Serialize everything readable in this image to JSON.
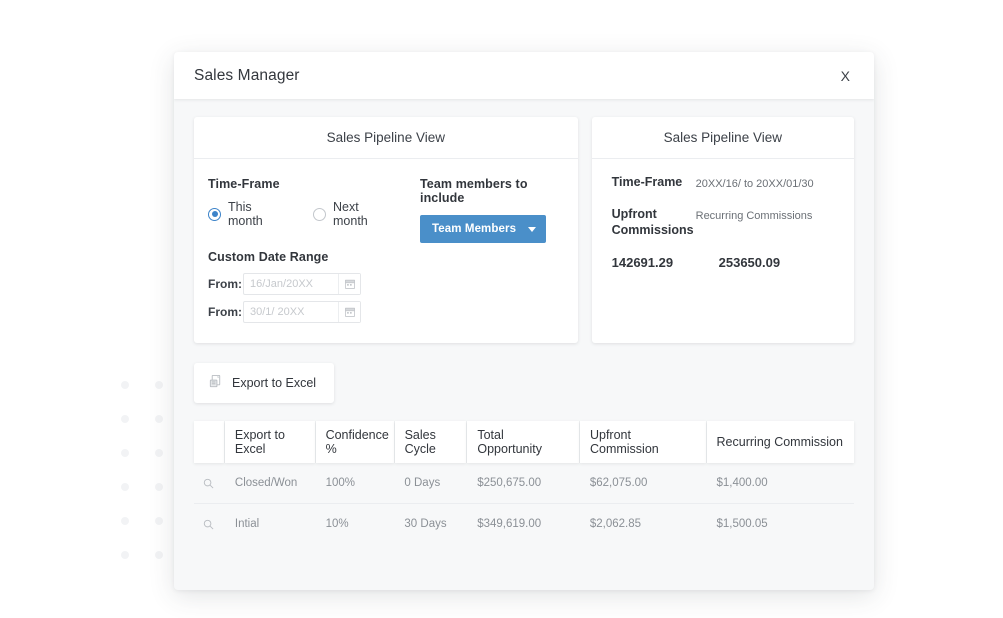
{
  "modal": {
    "title": "Sales Manager",
    "close_label": "X"
  },
  "left_panel": {
    "header": "Sales Pipeline View",
    "time_frame_label": "Time-Frame",
    "radios": [
      {
        "label": "This month",
        "selected": true
      },
      {
        "label": "Next month",
        "selected": false
      }
    ],
    "custom_date_range_label": "Custom Date Range",
    "date_rows": [
      {
        "prefix": "From:",
        "placeholder": "16/Jan/20XX",
        "value": ""
      },
      {
        "prefix": "From:",
        "placeholder": "30/1/ 20XX",
        "value": ""
      }
    ],
    "team_members_label": "Team members to include",
    "team_members_button": "Team Members"
  },
  "right_panel": {
    "header": "Sales Pipeline View",
    "time_frame_key": "Time-Frame",
    "time_frame_value": "20XX/16/ to 20XX/01/30",
    "upfront_key": "Upfront Commissions",
    "recurring_key": "Recurring Commissions",
    "upfront_amount": "142691.29",
    "recurring_amount": "253650.09"
  },
  "export": {
    "label": "Export to Excel"
  },
  "table": {
    "columns": [
      "",
      "Export to Excel",
      "Confidence %",
      "Sales Cycle",
      "Total Opportunity",
      "Upfront Commission",
      "Recurring Commission"
    ],
    "rows": [
      {
        "stage": "Closed/Won",
        "confidence": "100%",
        "sales_cycle": "0 Days",
        "total_opportunity": "$250,675.00",
        "upfront_commission": "$62,075.00",
        "recurring_commission": "$1,400.00"
      },
      {
        "stage": "Intial",
        "confidence": "10%",
        "sales_cycle": "30 Days",
        "total_opportunity": "$349,619.00",
        "upfront_commission": "$2,062.85",
        "recurring_commission": "$1,500.05"
      }
    ]
  },
  "colors": {
    "accent_blue": "#4a8fc9",
    "radio_blue": "#3c83c9",
    "modal_bg": "#f7f8f9",
    "dot": "#f2f3f5"
  }
}
